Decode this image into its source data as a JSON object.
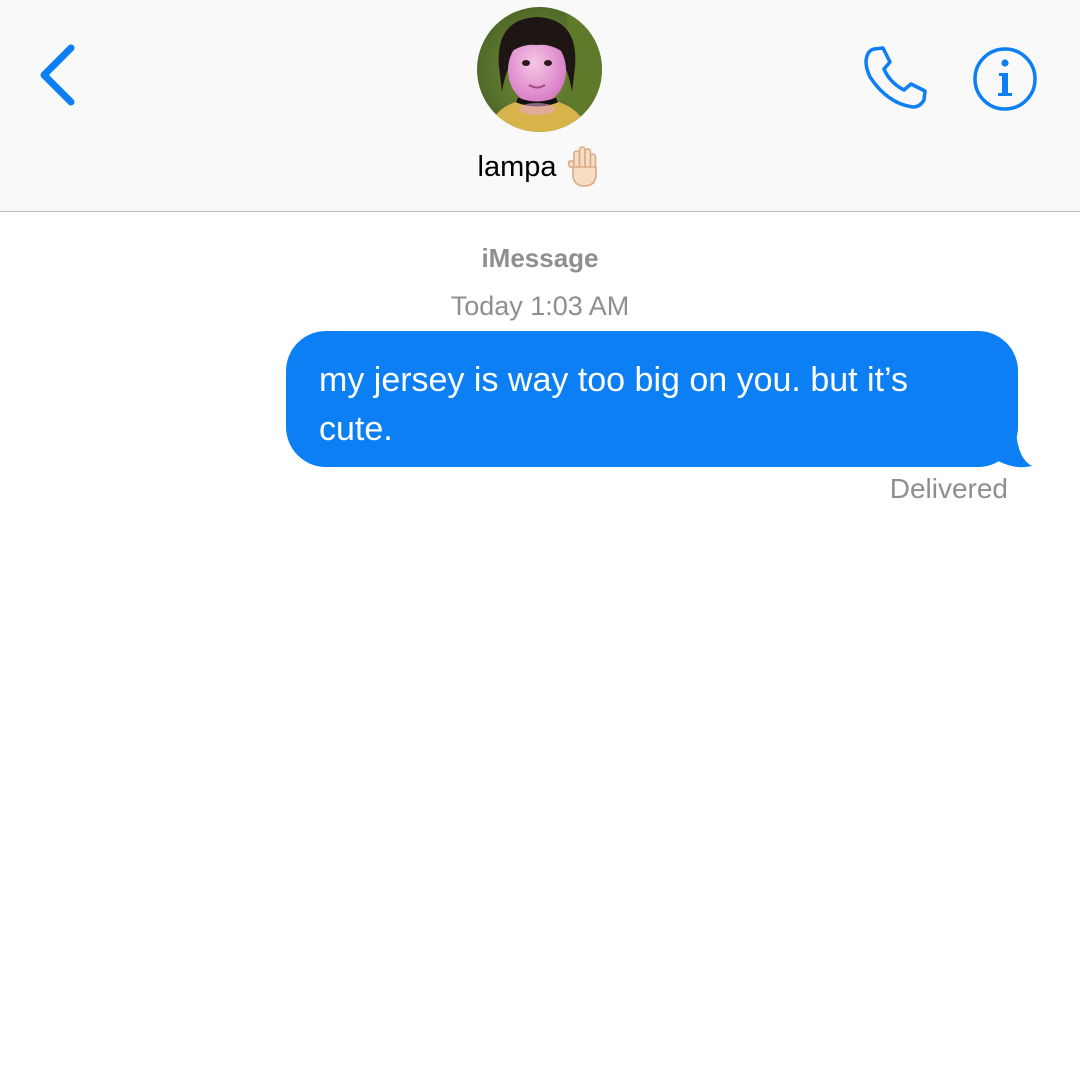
{
  "header": {
    "contact_name": "lampa",
    "status_emoji": "raised-hand-light-skin",
    "accent_color": "#0b7ff3"
  },
  "thread": {
    "service_label": "iMessage",
    "timestamp": "Today 1:03 AM",
    "messages": [
      {
        "direction": "outgoing",
        "text": "my jersey is way too big on you. but it’s cute.",
        "bubble_color": "#0b7ff3",
        "status": "Delivered"
      }
    ]
  }
}
